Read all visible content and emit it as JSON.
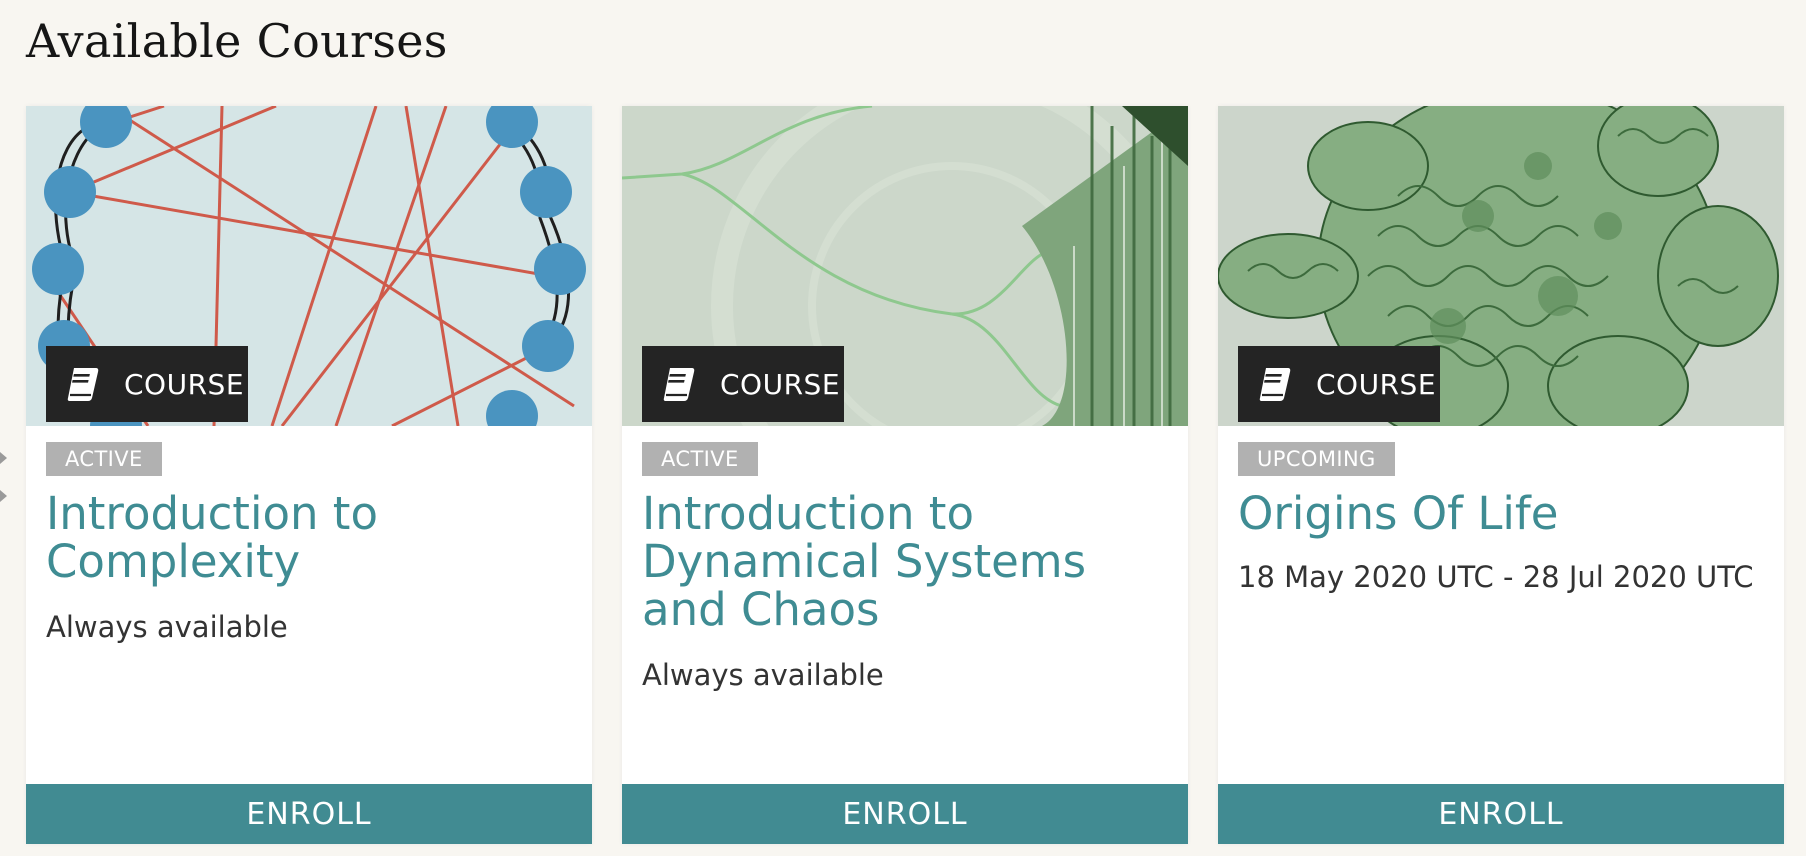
{
  "page": {
    "title": "Available Courses"
  },
  "courses": [
    {
      "type_label": "COURSE",
      "status": "ACTIVE",
      "title": "Introduction to Complexity",
      "availability": "Always available",
      "enroll_label": "ENROLL"
    },
    {
      "type_label": "COURSE",
      "status": "ACTIVE",
      "title": "Introduction to Dynamical Systems and Chaos",
      "availability": "Always available",
      "enroll_label": "ENROLL"
    },
    {
      "type_label": "COURSE",
      "status": "UPCOMING",
      "title": "Origins Of Life",
      "availability": "18 May 2020 UTC - 28 Jul 2020 UTC",
      "enroll_label": "ENROLL"
    }
  ],
  "colors": {
    "accent": "#418b92",
    "title_link": "#3f8c93",
    "tag_bg": "#242424",
    "badge_bg": "#b1b1b1",
    "page_bg": "#f8f6f1"
  }
}
